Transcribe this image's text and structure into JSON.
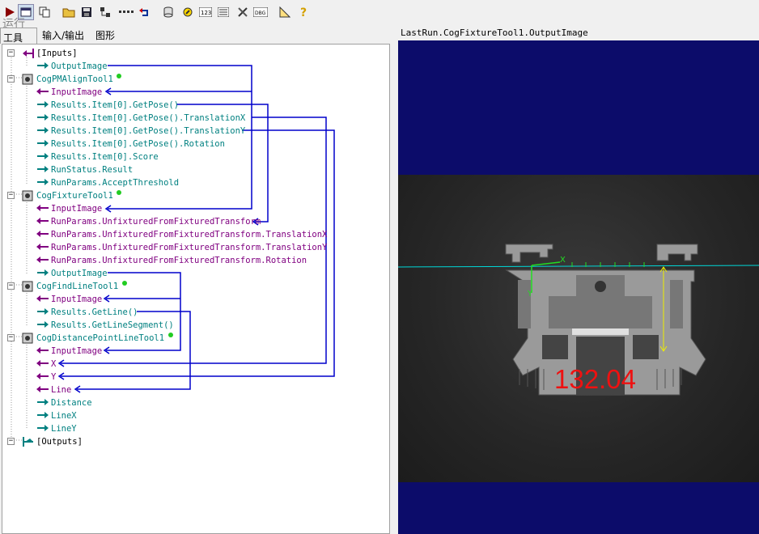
{
  "toolbar": {
    "run_label": "运行",
    "icons": [
      "run-icon",
      "window-icon",
      "copy-icon",
      "open-folder-icon",
      "save-icon",
      "tool-tree-icon",
      "ellipsis-icon",
      "undo-icon",
      "database-icon",
      "link-icon",
      "123-icon",
      "list-icon",
      "tools-icon",
      "dbg-icon",
      "ruler-icon",
      "help-icon"
    ]
  },
  "tabs": [
    "工具",
    "输入/输出",
    "图形"
  ],
  "tree": {
    "rows": [
      {
        "text": "[Inputs]",
        "color": "black"
      },
      {
        "text": "OutputImage",
        "color": "teal"
      },
      {
        "text": "CogPMAlignTool1",
        "color": "teal"
      },
      {
        "text": "InputImage",
        "color": "purple"
      },
      {
        "text": "Results.Item[0].GetPose()",
        "color": "teal"
      },
      {
        "text": "Results.Item[0].GetPose().TranslationX",
        "color": "teal"
      },
      {
        "text": "Results.Item[0].GetPose().TranslationY",
        "color": "teal"
      },
      {
        "text": "Results.Item[0].GetPose().Rotation",
        "color": "teal"
      },
      {
        "text": "Results.Item[0].Score",
        "color": "teal"
      },
      {
        "text": "RunStatus.Result",
        "color": "teal"
      },
      {
        "text": "RunParams.AcceptThreshold",
        "color": "teal"
      },
      {
        "text": "CogFixtureTool1",
        "color": "teal"
      },
      {
        "text": "InputImage",
        "color": "purple"
      },
      {
        "text": "RunParams.UnfixturedFromFixturedTransform",
        "color": "purple"
      },
      {
        "text": "RunParams.UnfixturedFromFixturedTransform.TranslationX",
        "color": "purple"
      },
      {
        "text": "RunParams.UnfixturedFromFixturedTransform.TranslationY",
        "color": "purple"
      },
      {
        "text": "RunParams.UnfixturedFromFixturedTransform.Rotation",
        "color": "purple"
      },
      {
        "text": "OutputImage",
        "color": "teal"
      },
      {
        "text": "CogFindLineTool1",
        "color": "teal"
      },
      {
        "text": "InputImage",
        "color": "purple"
      },
      {
        "text": "Results.GetLine()",
        "color": "teal"
      },
      {
        "text": "Results.GetLineSegment()",
        "color": "teal"
      },
      {
        "text": "CogDistancePointLineTool1",
        "color": "teal"
      },
      {
        "text": "InputImage",
        "color": "purple"
      },
      {
        "text": "X",
        "color": "purple"
      },
      {
        "text": "Y",
        "color": "purple"
      },
      {
        "text": "Line",
        "color": "purple"
      },
      {
        "text": "Distance",
        "color": "teal"
      },
      {
        "text": "LineX",
        "color": "teal"
      },
      {
        "text": "LineY",
        "color": "teal"
      },
      {
        "text": "[Outputs]",
        "color": "black"
      }
    ]
  },
  "image_panel": {
    "title": "LastRun.CogFixtureTool1.OutputImage",
    "result_value": "132.04"
  },
  "colors": {
    "teal": "#008080",
    "purple": "#800080",
    "wire": "#0000cc",
    "image_bg": "#0c0c6a",
    "result_text": "#ee1111",
    "green_dot": "#22cc22"
  }
}
